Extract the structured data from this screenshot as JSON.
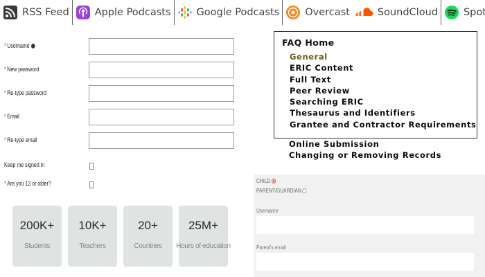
{
  "podcast_bar": {
    "items": [
      {
        "label": "RSS Feed",
        "icon": "rss-icon"
      },
      {
        "label": "Apple Podcasts",
        "icon": "apple-podcasts-icon"
      },
      {
        "label": "Google Podcasts",
        "icon": "google-podcasts-icon"
      },
      {
        "label": "Overcast",
        "icon": "overcast-icon"
      },
      {
        "label": "SoundCloud",
        "icon": "soundcloud-icon"
      },
      {
        "label": "Spotify",
        "icon": "spotify-icon"
      }
    ]
  },
  "registration": {
    "fields": [
      {
        "label": "Username",
        "required": true,
        "help_icon": "help-icon",
        "value": ""
      },
      {
        "label": "New password",
        "required": true,
        "value": ""
      },
      {
        "label": "Re-type password",
        "required": true,
        "value": ""
      },
      {
        "label": "Email",
        "required": true,
        "value": ""
      },
      {
        "label": "Re-type email",
        "required": true,
        "value": ""
      }
    ],
    "keep_signed_in": {
      "label": "Keep me signed in",
      "required": false,
      "checked": false
    },
    "age_check": {
      "label": "Are you 13 or older?",
      "required": true,
      "checked": false
    },
    "stats": [
      {
        "value": "200K+",
        "caption": "Students"
      },
      {
        "value": "10K+",
        "caption": "Teachers"
      },
      {
        "value": "20+",
        "caption": "Countries"
      },
      {
        "value": "25M+",
        "caption": "Hours of education"
      }
    ]
  },
  "faq": {
    "title": "FAQ Home",
    "items": [
      "General",
      "ERIC Content",
      "Full Text",
      "Peer Review",
      "Searching ERIC",
      "Thesaurus and Identifiers",
      "Grantee and Contractor Requirements"
    ],
    "overflow_items": [
      "Online Submission",
      "Changing or Removing Records"
    ],
    "active_item": "General"
  },
  "child_form": {
    "role_options": [
      {
        "label": "CHILD",
        "selected": true
      },
      {
        "label": "PARENT/GUARDIAN",
        "selected": false
      }
    ],
    "fields": [
      {
        "label": "Username",
        "value": ""
      },
      {
        "label": "Parent's email",
        "value": ""
      }
    ]
  },
  "colors": {
    "required_marker": "#c0392b",
    "stat_tile_bg": "#dfe3e2",
    "faq_active": "#6b5b14",
    "apple_podcasts": "#9b43d6",
    "overcast": "#f08a24",
    "soundcloud": "#ff5500",
    "spotify": "#1ed760"
  }
}
